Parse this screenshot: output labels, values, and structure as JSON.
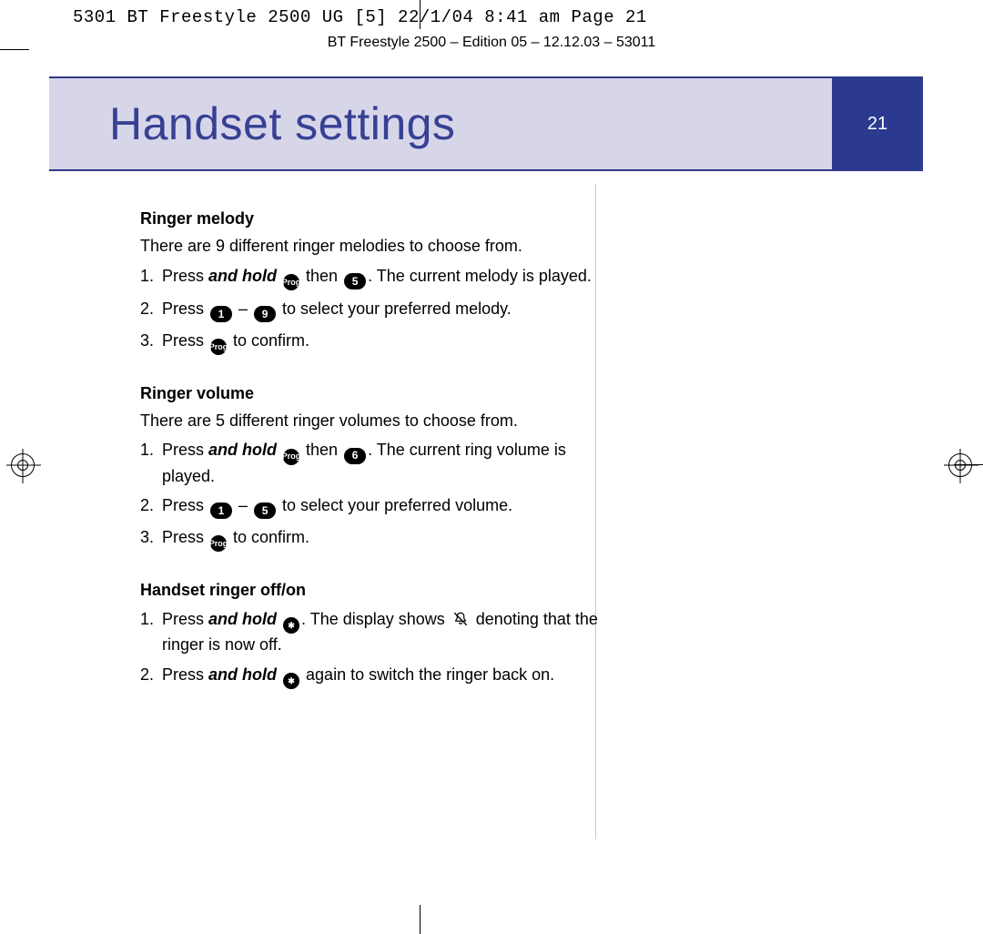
{
  "slug": "5301 BT Freestyle 2500 UG [5]  22/1/04  8:41 am  Page 21",
  "edition": "BT Freestyle 2500 – Edition 05 – 12.12.03 – 53011",
  "banner": {
    "title": "Handset settings",
    "page_number": "21"
  },
  "icons": {
    "prog": "Prog",
    "d1": "1",
    "d5": "5",
    "d6": "6",
    "d9": "9",
    "star": "✱",
    "bell_off_alt": "ringer-off-icon"
  },
  "sections": [
    {
      "heading": "Ringer melody",
      "intro": "There are 9 different ringer melodies to choose from.",
      "steps": [
        {
          "n": "1.",
          "pre": "Press ",
          "bi": "and hold",
          "seq": [
            "prog",
            " then ",
            "pill:d5"
          ],
          "post": ". The current melody is played."
        },
        {
          "n": "2.",
          "pre": "Press ",
          "seq": [
            "pill:d1",
            " – ",
            "pill:d9"
          ],
          "post": " to select your preferred melody."
        },
        {
          "n": "3.",
          "pre": "Press ",
          "seq": [
            "prog"
          ],
          "post": " to confirm."
        }
      ]
    },
    {
      "heading": "Ringer volume",
      "intro": "There are 5 different ringer volumes to choose from.",
      "steps": [
        {
          "n": "1.",
          "pre": "Press ",
          "bi": "and hold",
          "seq": [
            "prog",
            " then ",
            "pill:d6"
          ],
          "post": ". The current ring volume is played."
        },
        {
          "n": "2.",
          "pre": "Press ",
          "seq": [
            "pill:d1",
            " – ",
            "pill:d5"
          ],
          "post": " to select your preferred volume."
        },
        {
          "n": "3.",
          "pre": "Press ",
          "seq": [
            "prog"
          ],
          "post": " to confirm."
        }
      ]
    },
    {
      "heading": "Handset ringer off/on",
      "steps": [
        {
          "n": "1.",
          "pre": "Press ",
          "bi": "and hold",
          "seq": [
            "dot:star"
          ],
          "post1": ". The display shows ",
          "icon": "belloff",
          "post2": " denoting that the ringer is now off."
        },
        {
          "n": "2.",
          "pre": "Press ",
          "bi": "and hold",
          "seq": [
            "dot:star"
          ],
          "post": " again to switch the ringer back on."
        }
      ]
    }
  ]
}
